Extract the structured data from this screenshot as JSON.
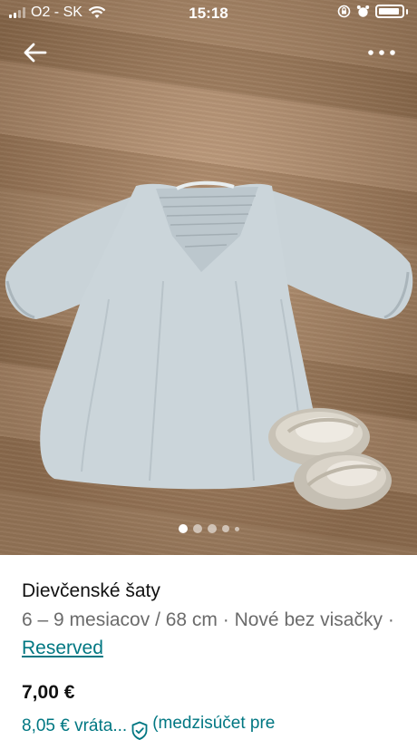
{
  "status_bar": {
    "carrier": "O2 - SK",
    "time": "15:18"
  },
  "gallery": {
    "image_count": 5,
    "active_index": 0,
    "photo_subject": "light blue baby dress and silver baby shoes on wooden floor"
  },
  "item": {
    "title": "Dievčenské šaty",
    "details": "6 – 9 mesiacov / 68 cm · Nové bez visačky · ",
    "reserved_label": "Reserved",
    "price": "7,00 €",
    "fee_price": "8,05 € vráta...",
    "fee_note": "(medzisúčet pre"
  },
  "colors": {
    "accent": "#007782",
    "text": "#111111",
    "muted": "#6b6b6b"
  },
  "icons": [
    "signal-icon",
    "wifi-icon",
    "rotation-lock-icon",
    "alarm-icon",
    "battery-icon",
    "back-arrow-icon",
    "more-icon",
    "shield-check-icon"
  ]
}
